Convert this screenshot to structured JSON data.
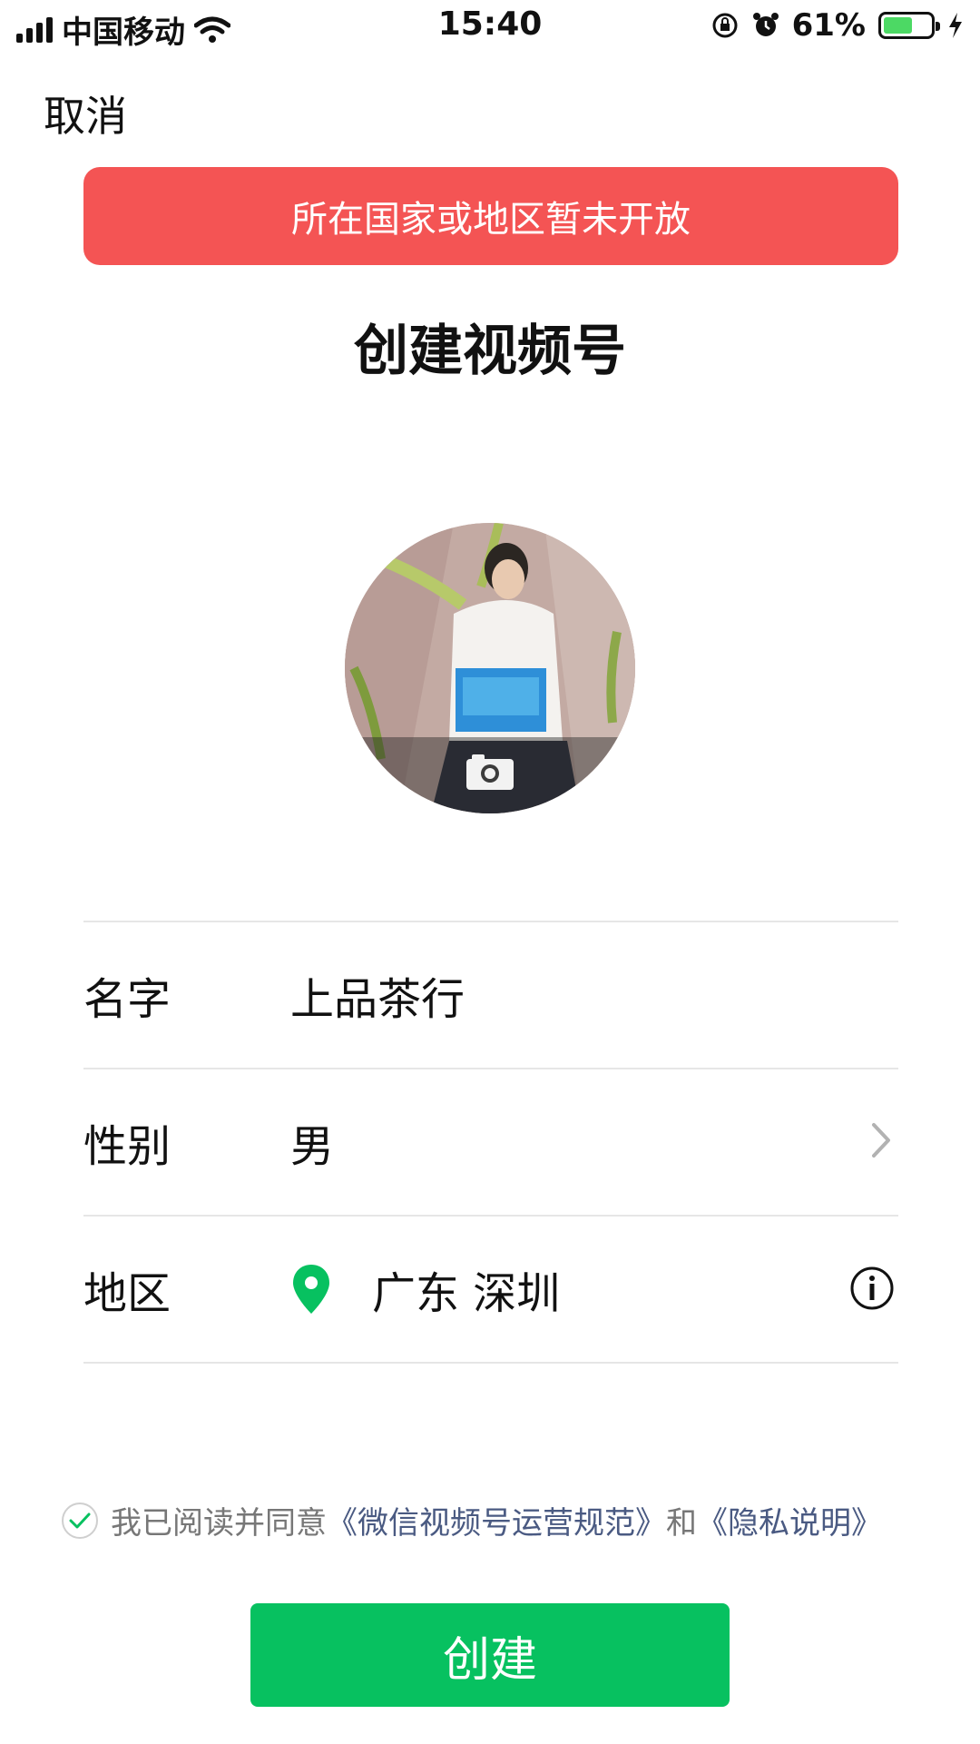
{
  "status_bar": {
    "carrier": "中国移动",
    "time": "15:40",
    "battery_percent": "61%",
    "battery_level": 0.61,
    "icons": [
      "signal-icon",
      "wifi-icon",
      "rotation-lock-icon",
      "alarm-icon",
      "battery-icon",
      "charging-icon"
    ]
  },
  "nav": {
    "cancel_label": "取消"
  },
  "banner": {
    "text": "所在国家或地区暂未开放",
    "color": "#f45454"
  },
  "page": {
    "title": "创建视频号"
  },
  "avatar": {
    "icon": "camera-icon"
  },
  "form": {
    "name": {
      "label": "名字",
      "value": "上品茶行"
    },
    "gender": {
      "label": "性别",
      "value": "男",
      "icon": "chevron-right-icon"
    },
    "region": {
      "label": "地区",
      "value": "广东 深圳",
      "icon": "location-pin-icon",
      "info_icon": "info-icon"
    }
  },
  "agreement": {
    "prefix": "我已阅读并同意",
    "link1": "《微信视频号运营规范》",
    "and": "和",
    "link2": "《隐私说明》"
  },
  "create_button": {
    "label": "创建",
    "color": "#07c160"
  },
  "colors": {
    "accent": "#07c160",
    "link": "#4a5a82",
    "pin": "#07c160"
  }
}
